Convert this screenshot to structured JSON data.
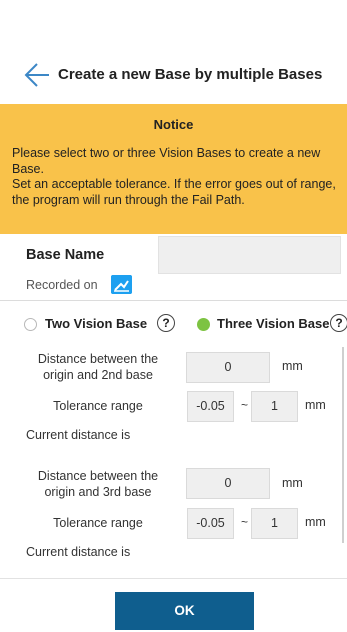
{
  "header": {
    "title": "Create a new Base by multiple Bases"
  },
  "notice": {
    "title": "Notice",
    "text": "Please select two or three Vision Bases to create a new Base.\nSet an acceptable tolerance. If the error goes out of range, the program will run through the Fail Path."
  },
  "base_name": {
    "label": "Base Name",
    "value": "",
    "recorded_label": "Recorded on"
  },
  "options": {
    "two": {
      "label": "Two Vision Base",
      "selected": false
    },
    "three": {
      "label": "Three Vision Base",
      "selected": true
    },
    "help_glyph": "?"
  },
  "section1": {
    "distance_label": "Distance between the\norigin and 2nd base",
    "distance_value": "0",
    "unit": "mm",
    "tolerance_label": "Tolerance range",
    "tol_min": "-0.05",
    "separator": "~",
    "tol_max": "1",
    "tol_unit": "mm",
    "current_label": "Current distance is"
  },
  "section2": {
    "distance_label": "Distance between the\norigin and 3rd base",
    "distance_value": "0",
    "unit": "mm",
    "tolerance_label": "Tolerance range",
    "tol_min": "-0.05",
    "separator": "~",
    "tol_max": "1",
    "tol_unit": "mm",
    "current_label": "Current distance is"
  },
  "ok_button": {
    "label": "OK"
  },
  "colors": {
    "accent": "#0f5e8e",
    "notice_bg": "#f9c24a",
    "selected_radio": "#7dc342",
    "record_icon": "#1da0f0"
  }
}
